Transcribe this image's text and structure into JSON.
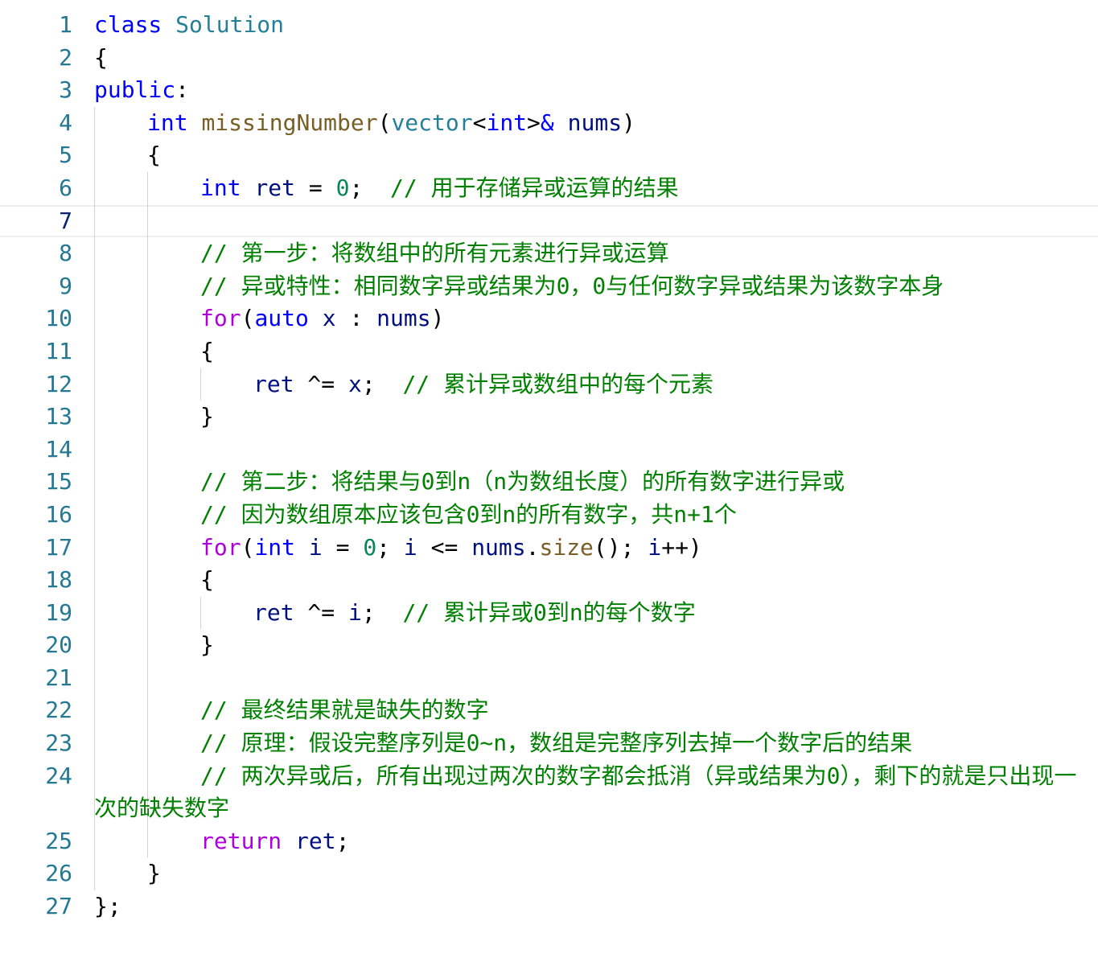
{
  "editor": {
    "current_line": 7,
    "lines": [
      {
        "n": "1",
        "indent": 0,
        "tokens": [
          [
            "kw",
            "class"
          ],
          [
            "op",
            " "
          ],
          [
            "ty",
            "Solution"
          ]
        ]
      },
      {
        "n": "2",
        "indent": 0,
        "tokens": [
          [
            "op",
            "{"
          ]
        ]
      },
      {
        "n": "3",
        "indent": 0,
        "tokens": [
          [
            "kw",
            "public"
          ],
          [
            "op",
            ":"
          ]
        ]
      },
      {
        "n": "4",
        "indent": 1,
        "tokens": [
          [
            "kw",
            "int"
          ],
          [
            "op",
            " "
          ],
          [
            "fn",
            "missingNumber"
          ],
          [
            "op",
            "("
          ],
          [
            "ty",
            "vector"
          ],
          [
            "op",
            "<"
          ],
          [
            "kw",
            "int"
          ],
          [
            "op",
            ">"
          ],
          [
            "kw",
            "&"
          ],
          [
            "op",
            " "
          ],
          [
            "var",
            "nums"
          ],
          [
            "op",
            ")"
          ]
        ]
      },
      {
        "n": "5",
        "indent": 1,
        "tokens": [
          [
            "op",
            "{"
          ]
        ]
      },
      {
        "n": "6",
        "indent": 2,
        "tokens": [
          [
            "kw",
            "int"
          ],
          [
            "op",
            " "
          ],
          [
            "var",
            "ret"
          ],
          [
            "op",
            " = "
          ],
          [
            "num",
            "0"
          ],
          [
            "op",
            ";  "
          ],
          [
            "cmt",
            "// 用于存储异或运算的结果"
          ]
        ]
      },
      {
        "n": "7",
        "indent": 0,
        "tokens": []
      },
      {
        "n": "8",
        "indent": 2,
        "tokens": [
          [
            "cmt",
            "// 第一步：将数组中的所有元素进行异或运算"
          ]
        ]
      },
      {
        "n": "9",
        "indent": 2,
        "tokens": [
          [
            "cmt",
            "// 异或特性：相同数字异或结果为0，0与任何数字异或结果为该数字本身"
          ]
        ]
      },
      {
        "n": "10",
        "indent": 2,
        "tokens": [
          [
            "ctl",
            "for"
          ],
          [
            "op",
            "("
          ],
          [
            "kw",
            "auto"
          ],
          [
            "op",
            " "
          ],
          [
            "var",
            "x"
          ],
          [
            "op",
            " : "
          ],
          [
            "var",
            "nums"
          ],
          [
            "op",
            ")"
          ]
        ]
      },
      {
        "n": "11",
        "indent": 2,
        "tokens": [
          [
            "op",
            "{"
          ]
        ]
      },
      {
        "n": "12",
        "indent": 3,
        "tokens": [
          [
            "var",
            "ret"
          ],
          [
            "op",
            " ^= "
          ],
          [
            "var",
            "x"
          ],
          [
            "op",
            ";  "
          ],
          [
            "cmt",
            "// 累计异或数组中的每个元素"
          ]
        ]
      },
      {
        "n": "13",
        "indent": 2,
        "tokens": [
          [
            "op",
            "}"
          ]
        ]
      },
      {
        "n": "14",
        "indent": 0,
        "tokens": []
      },
      {
        "n": "15",
        "indent": 2,
        "tokens": [
          [
            "cmt",
            "// 第二步：将结果与0到n（n为数组长度）的所有数字进行异或"
          ]
        ]
      },
      {
        "n": "16",
        "indent": 2,
        "tokens": [
          [
            "cmt",
            "// 因为数组原本应该包含0到n的所有数字，共n+1个"
          ]
        ]
      },
      {
        "n": "17",
        "indent": 2,
        "tokens": [
          [
            "ctl",
            "for"
          ],
          [
            "op",
            "("
          ],
          [
            "kw",
            "int"
          ],
          [
            "op",
            " "
          ],
          [
            "var",
            "i"
          ],
          [
            "op",
            " = "
          ],
          [
            "num",
            "0"
          ],
          [
            "op",
            "; "
          ],
          [
            "var",
            "i"
          ],
          [
            "op",
            " <= "
          ],
          [
            "var",
            "nums"
          ],
          [
            "op",
            "."
          ],
          [
            "fn",
            "size"
          ],
          [
            "op",
            "(); "
          ],
          [
            "var",
            "i"
          ],
          [
            "op",
            "++)"
          ]
        ]
      },
      {
        "n": "18",
        "indent": 2,
        "tokens": [
          [
            "op",
            "{"
          ]
        ]
      },
      {
        "n": "19",
        "indent": 3,
        "tokens": [
          [
            "var",
            "ret"
          ],
          [
            "op",
            " ^= "
          ],
          [
            "var",
            "i"
          ],
          [
            "op",
            ";  "
          ],
          [
            "cmt",
            "// 累计异或0到n的每个数字"
          ]
        ]
      },
      {
        "n": "20",
        "indent": 2,
        "tokens": [
          [
            "op",
            "}"
          ]
        ]
      },
      {
        "n": "21",
        "indent": 0,
        "tokens": []
      },
      {
        "n": "22",
        "indent": 2,
        "tokens": [
          [
            "cmt",
            "// 最终结果就是缺失的数字"
          ]
        ]
      },
      {
        "n": "23",
        "indent": 2,
        "tokens": [
          [
            "cmt",
            "// 原理：假设完整序列是0~n，数组是完整序列去掉一个数字后的结果"
          ]
        ]
      },
      {
        "n": "24",
        "indent": 2,
        "wrap": true,
        "tokens": [
          [
            "cmt",
            "// 两次异或后，所有出现过两次的数字都会抵消（异或结果为0），剩下的就是只出现一次的缺失数字"
          ]
        ]
      },
      {
        "n": "25",
        "indent": 2,
        "tokens": [
          [
            "ctl",
            "return"
          ],
          [
            "op",
            " "
          ],
          [
            "var",
            "ret"
          ],
          [
            "op",
            ";"
          ]
        ]
      },
      {
        "n": "26",
        "indent": 1,
        "tokens": [
          [
            "op",
            "}"
          ]
        ]
      },
      {
        "n": "27",
        "indent": 0,
        "tokens": [
          [
            "op",
            "};"
          ]
        ]
      }
    ]
  }
}
